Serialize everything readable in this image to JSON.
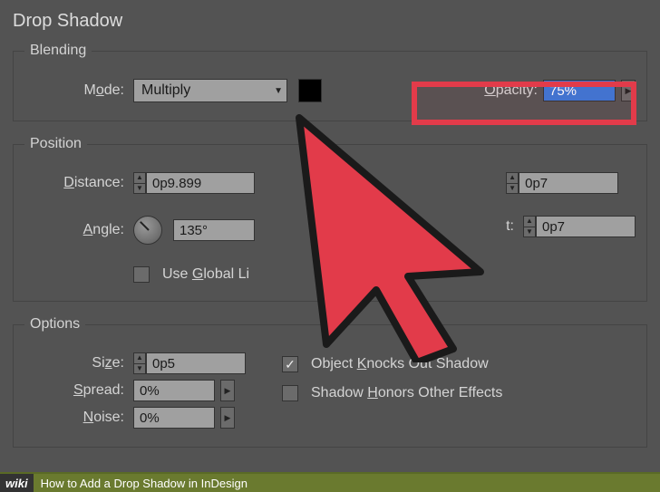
{
  "title": "Drop Shadow",
  "blending": {
    "legend": "Blending",
    "mode_label_pre": "M",
    "mode_label_ul": "o",
    "mode_label_post": "de:",
    "mode_value": "Multiply",
    "opacity_label_ul": "O",
    "opacity_label_post": "pacity:",
    "opacity_value": "75%"
  },
  "position": {
    "legend": "Position",
    "distance_label_ul": "D",
    "distance_label_post": "istance:",
    "distance_value": "0p9.899",
    "angle_label_ul": "A",
    "angle_label_post": "ngle:",
    "angle_value": "135°",
    "use_global_pre": "Use ",
    "use_global_ul": "G",
    "use_global_post": "lobal Li",
    "xoffset_value": "0p7",
    "yoffset_label": "t:",
    "yoffset_value": "0p7"
  },
  "options": {
    "legend": "Options",
    "size_label_pre": "Si",
    "size_label_ul": "z",
    "size_label_post": "e:",
    "size_value": "0p5",
    "spread_label_ul": "S",
    "spread_label_post": "pread:",
    "spread_value": "0%",
    "noise_label_ul": "N",
    "noise_label_post": "oise:",
    "noise_value": "0%",
    "knocks_pre": "Object ",
    "knocks_ul": "K",
    "knocks_post": "nocks Out Shadow",
    "honors_pre": "Shadow ",
    "honors_ul": "H",
    "honors_post": "onors Other Effects"
  },
  "footer": {
    "wiki": "wiki",
    "text": "How to Add a Drop Shadow in InDesign"
  }
}
